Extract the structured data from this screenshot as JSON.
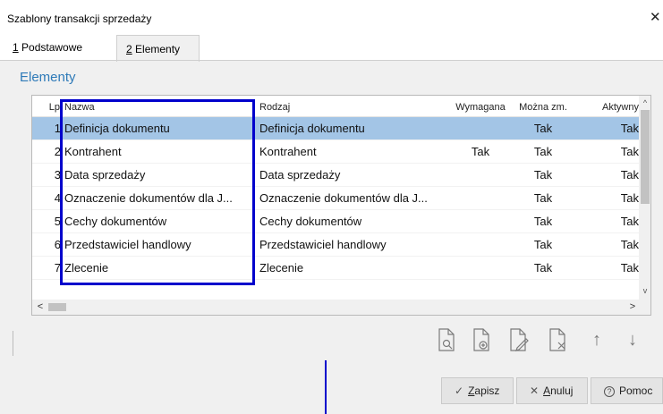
{
  "window": {
    "title": "Szablony transakcji sprzedaży",
    "close_glyph": "✕"
  },
  "tabs": [
    {
      "mnemonic": "1",
      "label": " Podstawowe"
    },
    {
      "mnemonic": "2",
      "label": " Elementy"
    }
  ],
  "section": {
    "title": "Elementy"
  },
  "grid": {
    "columns": {
      "lp": "Lp",
      "name": "Nazwa",
      "kind": "Rodzaj",
      "required": "Wymagana",
      "changeable": "Można zm.",
      "active": "Aktywny"
    },
    "rows": [
      {
        "lp": "1",
        "name": "Definicja dokumentu",
        "kind": "Definicja dokumentu",
        "required": "",
        "changeable": "Tak",
        "active": "Tak"
      },
      {
        "lp": "2",
        "name": "Kontrahent",
        "kind": "Kontrahent",
        "required": "Tak",
        "changeable": "Tak",
        "active": "Tak"
      },
      {
        "lp": "3",
        "name": "Data sprzedaży",
        "kind": "Data sprzedaży",
        "required": "",
        "changeable": "Tak",
        "active": "Tak"
      },
      {
        "lp": "4",
        "name": "Oznaczenie dokumentów dla J...",
        "kind": "Oznaczenie dokumentów dla J...",
        "required": "",
        "changeable": "Tak",
        "active": "Tak"
      },
      {
        "lp": "5",
        "name": "Cechy dokumentów",
        "kind": "Cechy dokumentów",
        "required": "",
        "changeable": "Tak",
        "active": "Tak"
      },
      {
        "lp": "6",
        "name": "Przedstawiciel handlowy",
        "kind": "Przedstawiciel handlowy",
        "required": "",
        "changeable": "Tak",
        "active": "Tak"
      },
      {
        "lp": "7",
        "name": "Zlecenie",
        "kind": "Zlecenie",
        "required": "",
        "changeable": "Tak",
        "active": "Tak"
      }
    ],
    "selected_row": 1,
    "scroll": {
      "up": "^",
      "down": "v",
      "left": "<",
      "right": ">"
    }
  },
  "toolbar": {
    "icons": [
      "document-preview-icon",
      "document-add-icon",
      "document-edit-icon",
      "document-delete-icon",
      "arrow-up-icon",
      "arrow-down-icon"
    ],
    "up_glyph": "↑",
    "down_glyph": "↓"
  },
  "buttons": {
    "save": {
      "glyph": "✓",
      "mnemonic": "Z",
      "rest": "apisz"
    },
    "cancel": {
      "glyph": "✕",
      "mnemonic": "A",
      "rest": "nuluj"
    },
    "help": {
      "glyph": "?",
      "label": "Pomoc"
    }
  },
  "colors": {
    "accent": "#2e7ab8",
    "selection": "#a3c5e6",
    "highlight": "#0000cc"
  }
}
